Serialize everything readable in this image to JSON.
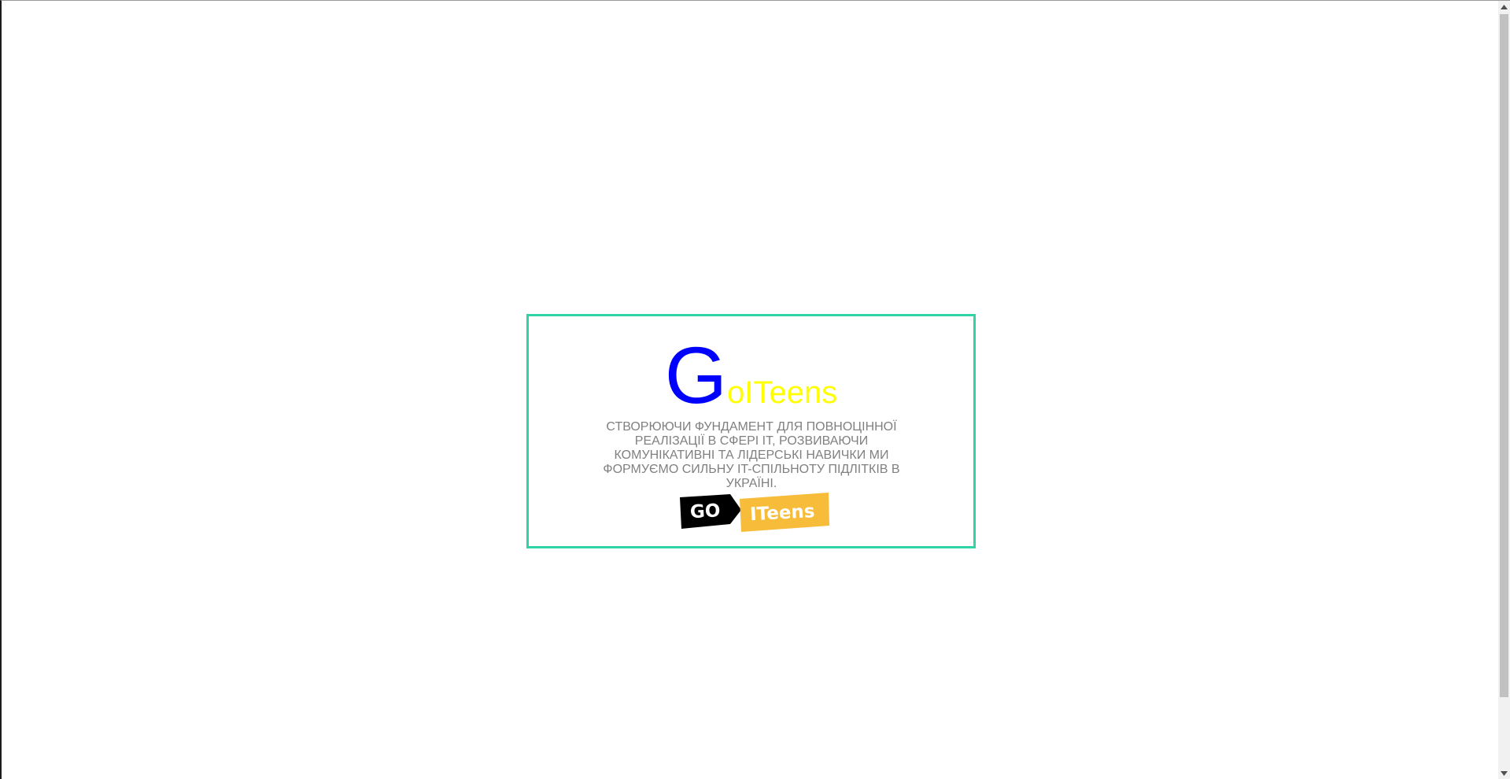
{
  "brand": {
    "first_letter": "G",
    "rest": "oITeens",
    "first_letter_color": "#0000ff",
    "rest_color": "#ffff00"
  },
  "tagline": "Створюючи фундамент для повноцінної реалізації в сфері IT, розвиваючи комунікативні та лідерські навички ми формуємо сильну IT-спільноту підлітків в Україні.",
  "logo": {
    "go_text": "GO",
    "iteens_text": "ITeens",
    "go_color": "#000000",
    "iteens_color": "#f7bd3a"
  },
  "card_border_color": "#2ed3a6",
  "scrollbar": {
    "up_icon": "triangle-up-icon",
    "down_icon": "triangle-down-icon"
  }
}
